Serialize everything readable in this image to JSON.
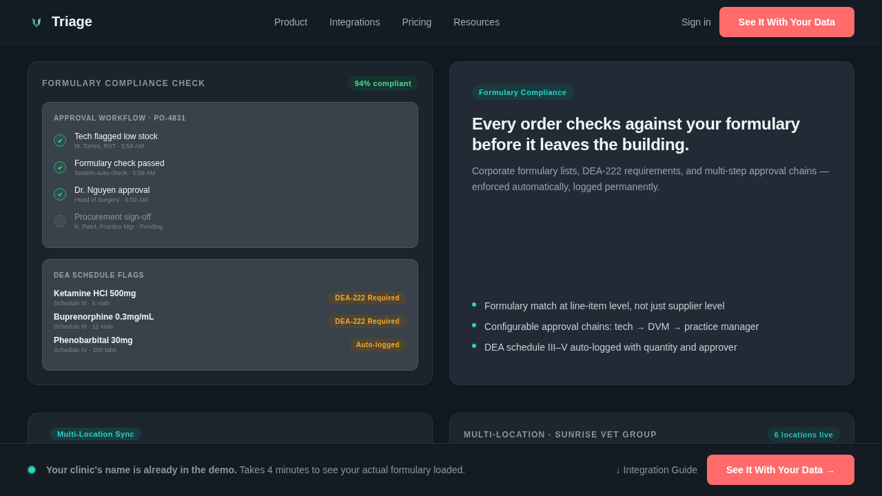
{
  "header": {
    "brand": "Triage",
    "nav": [
      "Product",
      "Integrations",
      "Pricing",
      "Resources"
    ],
    "sign_in": "Sign in",
    "cta": "See It With Your Data"
  },
  "compliance_card": {
    "title": "FORMULARY COMPLIANCE CHECK",
    "badge": "94% compliant",
    "workflow": {
      "title": "APPROVAL WORKFLOW · PO-4831",
      "steps": [
        {
          "label": "Tech flagged low stock",
          "meta": "M. Torres, RVT · 5:58 AM",
          "done": true
        },
        {
          "label": "Formulary check passed",
          "meta": "System auto-check · 5:58 AM",
          "done": true
        },
        {
          "label": "Dr. Nguyen approval",
          "meta": "Head of Surgery · 6:02 AM",
          "done": true
        },
        {
          "label": "Procurement sign-off",
          "meta": "K. Patel, Practice Mgr · Pending",
          "done": false
        }
      ]
    },
    "dea": {
      "title": "DEA SCHEDULE FLAGS",
      "items": [
        {
          "name": "Ketamine HCl 500mg",
          "meta": "Schedule III · 6 vials",
          "flag": "DEA-222 Required"
        },
        {
          "name": "Buprenorphine 0.3mg/mL",
          "meta": "Schedule III · 12 vials",
          "flag": "DEA-222 Required"
        },
        {
          "name": "Phenobarbital 30mg",
          "meta": "Schedule IV · 200 tabs",
          "flag": "Auto-logged"
        }
      ]
    }
  },
  "feature_card": {
    "tag": "Formulary Compliance",
    "heading": "Every order checks against your formulary before it leaves the building.",
    "description": "Corporate formulary lists, DEA-222 requirements, and multi-step approval chains — enforced automatically, logged permanently.",
    "bullets": [
      "Formulary match at line-item level, not just supplier level",
      "Configurable approval chains: tech → DVM → practice manager",
      "DEA schedule III–V auto-logged with quantity and approver"
    ]
  },
  "sync_card": {
    "tag": "Multi-Location Sync"
  },
  "location_card": {
    "title": "MULTI-LOCATION · SUNRISE VET GROUP",
    "badge": "6 locations live"
  },
  "bottom_bar": {
    "message": "**Your clinic's name is already in the demo.** Takes 4 minutes to see your actual formulary loaded.",
    "link": "↓ Integration Guide",
    "cta": "See It With Your Data →"
  }
}
